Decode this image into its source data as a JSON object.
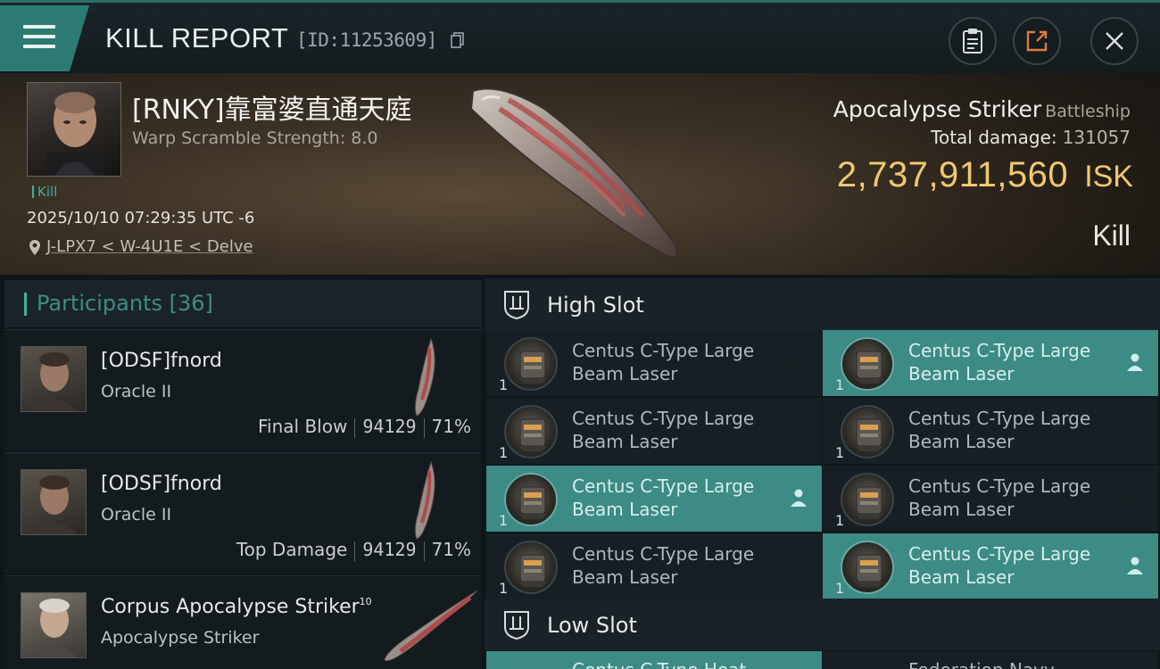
{
  "header": {
    "title": "KILL REPORT",
    "id_text": "[ID:11253609]"
  },
  "victim": {
    "pilot_name": "[RNKY]靠富婆直通天庭",
    "warp_scramble": "Warp Scramble Strength: 8.0",
    "kill_tag": "Kill",
    "datetime": "2025/10/10 07:29:35 UTC -6",
    "location": "J-LPX7 < W-4U1E < Delve",
    "ship_name": "Apocalypse Striker",
    "ship_class": "Battleship",
    "total_damage_label": "Total damage:",
    "total_damage_value": "131057",
    "isk_value": "2,737,911,560",
    "isk_unit": "ISK",
    "result": "Kill"
  },
  "participants": {
    "label": "Participants",
    "count": "[36]",
    "rows": [
      {
        "name": "[ODSF]fnord",
        "ship": "Oracle II",
        "role": "Final Blow",
        "damage": "94129",
        "percent": "71%"
      },
      {
        "name": "[ODSF]fnord",
        "ship": "Oracle II",
        "role": "Top Damage",
        "damage": "94129",
        "percent": "71%"
      },
      {
        "name": "Corpus Apocalypse Striker",
        "sup": "10",
        "ship": "Apocalypse Striker"
      }
    ]
  },
  "fitting": {
    "high_slot_label": "High Slot",
    "low_slot_label": "Low Slot",
    "module_line1": "Centus C-Type Large",
    "module_line2": "Beam Laser",
    "qty": "1",
    "modules": [
      {
        "state": "destroyed"
      },
      {
        "state": "dropped"
      },
      {
        "state": "destroyed"
      },
      {
        "state": "destroyed"
      },
      {
        "state": "dropped"
      },
      {
        "state": "destroyed"
      },
      {
        "state": "destroyed"
      },
      {
        "state": "dropped"
      }
    ],
    "low_slot_partial": [
      "Centus C-Type Heat ...",
      "Federation Navy ..."
    ]
  },
  "colors": {
    "accent": "#3fb0a2",
    "highlight": "#3c8b84",
    "isk": "#f0c870"
  },
  "icons": [
    "menu-icon",
    "clipboard-icon",
    "share-icon",
    "close-icon",
    "location-pin-icon",
    "copy-icon",
    "slot-icon",
    "destroyed-x-icon",
    "dropped-person-icon"
  ]
}
